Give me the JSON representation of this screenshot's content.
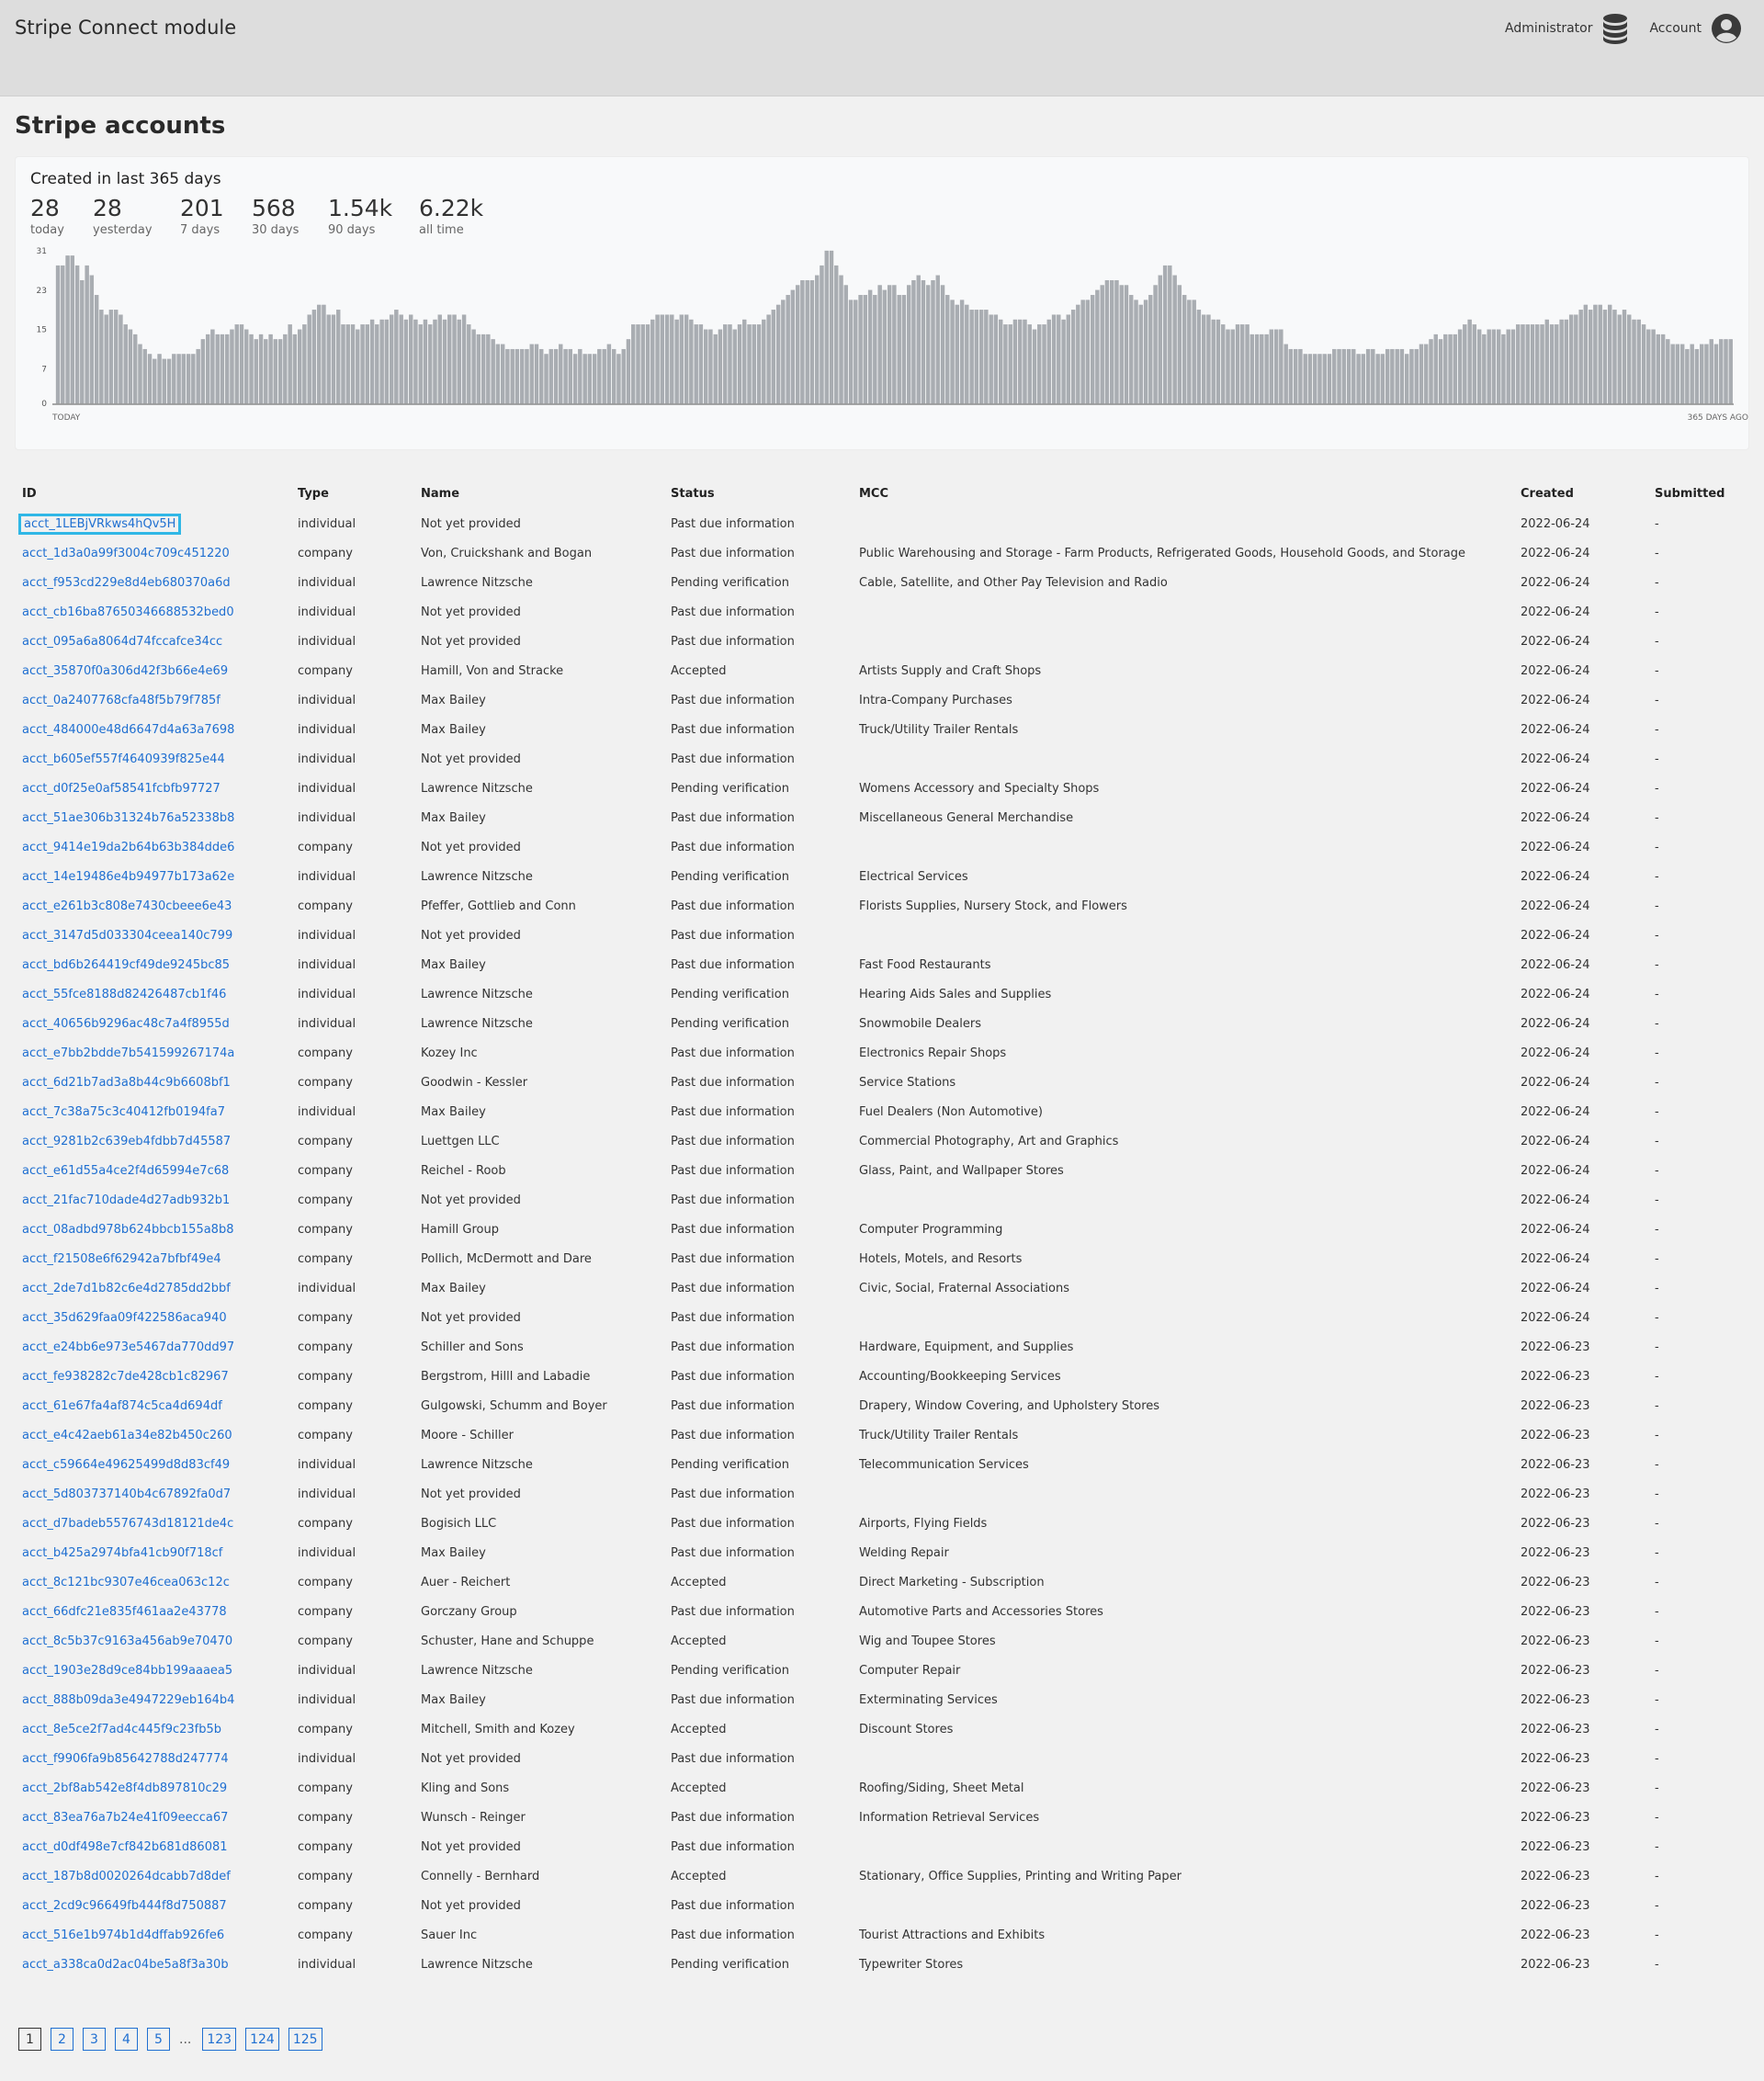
{
  "header": {
    "app_title": "Stripe Connect module",
    "admin_label": "Administrator",
    "account_label": "Account",
    "admin_icon": "database-icon",
    "account_icon": "user-circle-icon"
  },
  "page_title": "Stripe accounts",
  "stats": {
    "title": "Created in last 365 days",
    "items": [
      {
        "value": "28",
        "label": "today"
      },
      {
        "value": "28",
        "label": "yesterday"
      },
      {
        "value": "201",
        "label": "7 days"
      },
      {
        "value": "568",
        "label": "30 days"
      },
      {
        "value": "1.54k",
        "label": "90 days"
      },
      {
        "value": "6.22k",
        "label": "all time"
      }
    ]
  },
  "chart_data": {
    "type": "bar",
    "title": "",
    "y_ticks": [
      0,
      7,
      15,
      23,
      31
    ],
    "ylim": [
      0,
      31
    ],
    "x_label_left": "TODAY",
    "x_label_right": "365 DAYS AGO",
    "bar_color": "#a9adb2",
    "values": [
      28,
      28,
      30,
      30,
      28,
      25,
      28,
      26,
      22,
      19,
      18,
      19,
      19,
      18,
      16,
      15,
      14,
      12,
      11,
      10,
      9,
      10,
      9,
      9,
      10,
      10,
      10,
      10,
      10,
      11,
      13,
      14,
      15,
      14,
      14,
      14,
      15,
      16,
      16,
      15,
      14,
      13,
      14,
      13,
      14,
      13,
      13,
      14,
      16,
      14,
      15,
      16,
      18,
      19,
      20,
      20,
      18,
      18,
      19,
      16,
      16,
      16,
      15,
      16,
      16,
      17,
      16,
      17,
      17,
      18,
      19,
      18,
      17,
      18,
      17,
      16,
      17,
      16,
      17,
      18,
      17,
      18,
      18,
      17,
      18,
      16,
      15,
      14,
      14,
      14,
      13,
      12,
      12,
      11,
      11,
      11,
      11,
      11,
      12,
      12,
      11,
      10,
      11,
      11,
      12,
      11,
      11,
      10,
      11,
      10,
      10,
      10,
      11,
      11,
      12,
      11,
      10,
      11,
      13,
      16,
      16,
      16,
      16,
      17,
      18,
      18,
      18,
      18,
      17,
      18,
      18,
      17,
      16,
      16,
      15,
      15,
      14,
      15,
      16,
      16,
      15,
      16,
      17,
      16,
      16,
      16,
      17,
      18,
      19,
      20,
      21,
      22,
      23,
      24,
      25,
      25,
      25,
      26,
      28,
      31,
      31,
      28,
      26,
      24,
      21,
      21,
      22,
      22,
      23,
      22,
      24,
      23,
      24,
      24,
      22,
      22,
      24,
      25,
      26,
      25,
      24,
      25,
      26,
      24,
      22,
      21,
      20,
      21,
      20,
      19,
      19,
      19,
      19,
      18,
      18,
      17,
      16,
      16,
      17,
      17,
      17,
      16,
      15,
      16,
      16,
      17,
      18,
      18,
      17,
      18,
      19,
      20,
      21,
      21,
      22,
      23,
      24,
      25,
      25,
      25,
      24,
      24,
      22,
      21,
      20,
      21,
      22,
      24,
      26,
      28,
      28,
      26,
      24,
      22,
      21,
      21,
      19,
      18,
      18,
      17,
      17,
      16,
      15,
      15,
      16,
      16,
      16,
      14,
      14,
      14,
      14,
      15,
      15,
      15,
      12,
      11,
      11,
      11,
      10,
      10,
      10,
      10,
      10,
      10,
      11,
      11,
      11,
      11,
      11,
      10,
      10,
      11,
      11,
      10,
      10,
      11,
      11,
      11,
      11,
      10,
      11,
      11,
      12,
      12,
      13,
      14,
      13,
      14,
      14,
      14,
      15,
      16,
      17,
      16,
      15,
      14,
      15,
      15,
      15,
      14,
      15,
      15,
      16,
      16,
      16,
      16,
      16,
      16,
      17,
      16,
      16,
      17,
      17,
      18,
      18,
      19,
      20,
      19,
      20,
      20,
      19,
      20,
      19,
      18,
      19,
      18,
      17,
      17,
      16,
      15,
      15,
      14,
      14,
      13,
      12,
      12,
      12,
      11,
      12,
      11,
      12,
      12,
      13,
      12,
      13,
      13,
      13
    ],
    "note_order": "values listed from TODAY (left) to 365 DAYS AGO (right)"
  },
  "table": {
    "columns": [
      "ID",
      "Type",
      "Name",
      "Status",
      "MCC",
      "Created",
      "Submitted"
    ],
    "rows": [
      [
        "acct_1LEBjVRkws4hQv5H",
        "individual",
        "Not yet provided",
        "Past due information",
        "",
        "2022-06-24",
        "-"
      ],
      [
        "acct_1d3a0a99f3004c709c451220",
        "company",
        "Von, Cruickshank and Bogan",
        "Past due information",
        "Public Warehousing and Storage - Farm Products, Refrigerated Goods, Household Goods, and Storage",
        "2022-06-24",
        "-"
      ],
      [
        "acct_f953cd229e8d4eb680370a6d",
        "individual",
        "Lawrence Nitzsche",
        "Pending verification",
        "Cable, Satellite, and Other Pay Television and Radio",
        "2022-06-24",
        "-"
      ],
      [
        "acct_cb16ba87650346688532bed0",
        "individual",
        "Not yet provided",
        "Past due information",
        "",
        "2022-06-24",
        "-"
      ],
      [
        "acct_095a6a8064d74fccafce34cc",
        "individual",
        "Not yet provided",
        "Past due information",
        "",
        "2022-06-24",
        "-"
      ],
      [
        "acct_35870f0a306d42f3b66e4e69",
        "company",
        "Hamill, Von and Stracke",
        "Accepted",
        "Artists Supply and Craft Shops",
        "2022-06-24",
        "-"
      ],
      [
        "acct_0a2407768cfa48f5b79f785f",
        "individual",
        "Max Bailey",
        "Past due information",
        "Intra-Company Purchases",
        "2022-06-24",
        "-"
      ],
      [
        "acct_484000e48d6647d4a63a7698",
        "individual",
        "Max Bailey",
        "Past due information",
        "Truck/Utility Trailer Rentals",
        "2022-06-24",
        "-"
      ],
      [
        "acct_b605ef557f4640939f825e44",
        "individual",
        "Not yet provided",
        "Past due information",
        "",
        "2022-06-24",
        "-"
      ],
      [
        "acct_d0f25e0af58541fcbfb97727",
        "individual",
        "Lawrence Nitzsche",
        "Pending verification",
        "Womens Accessory and Specialty Shops",
        "2022-06-24",
        "-"
      ],
      [
        "acct_51ae306b31324b76a52338b8",
        "individual",
        "Max Bailey",
        "Past due information",
        "Miscellaneous General Merchandise",
        "2022-06-24",
        "-"
      ],
      [
        "acct_9414e19da2b64b63b384dde6",
        "company",
        "Not yet provided",
        "Past due information",
        "",
        "2022-06-24",
        "-"
      ],
      [
        "acct_14e19486e4b94977b173a62e",
        "individual",
        "Lawrence Nitzsche",
        "Pending verification",
        "Electrical Services",
        "2022-06-24",
        "-"
      ],
      [
        "acct_e261b3c808e7430cbeee6e43",
        "company",
        "Pfeffer, Gottlieb and Conn",
        "Past due information",
        "Florists Supplies, Nursery Stock, and Flowers",
        "2022-06-24",
        "-"
      ],
      [
        "acct_3147d5d033304ceea140c799",
        "individual",
        "Not yet provided",
        "Past due information",
        "",
        "2022-06-24",
        "-"
      ],
      [
        "acct_bd6b264419cf49de9245bc85",
        "individual",
        "Max Bailey",
        "Past due information",
        "Fast Food Restaurants",
        "2022-06-24",
        "-"
      ],
      [
        "acct_55fce8188d82426487cb1f46",
        "individual",
        "Lawrence Nitzsche",
        "Pending verification",
        "Hearing Aids Sales and Supplies",
        "2022-06-24",
        "-"
      ],
      [
        "acct_40656b9296ac48c7a4f8955d",
        "individual",
        "Lawrence Nitzsche",
        "Pending verification",
        "Snowmobile Dealers",
        "2022-06-24",
        "-"
      ],
      [
        "acct_e7bb2bdde7b541599267174a",
        "company",
        "Kozey Inc",
        "Past due information",
        "Electronics Repair Shops",
        "2022-06-24",
        "-"
      ],
      [
        "acct_6d21b7ad3a8b44c9b6608bf1",
        "company",
        "Goodwin - Kessler",
        "Past due information",
        "Service Stations",
        "2022-06-24",
        "-"
      ],
      [
        "acct_7c38a75c3c40412fb0194fa7",
        "individual",
        "Max Bailey",
        "Past due information",
        "Fuel Dealers (Non Automotive)",
        "2022-06-24",
        "-"
      ],
      [
        "acct_9281b2c639eb4fdbb7d45587",
        "company",
        "Luettgen LLC",
        "Past due information",
        "Commercial Photography, Art and Graphics",
        "2022-06-24",
        "-"
      ],
      [
        "acct_e61d55a4ce2f4d65994e7c68",
        "company",
        "Reichel - Roob",
        "Past due information",
        "Glass, Paint, and Wallpaper Stores",
        "2022-06-24",
        "-"
      ],
      [
        "acct_21fac710dade4d27adb932b1",
        "company",
        "Not yet provided",
        "Past due information",
        "",
        "2022-06-24",
        "-"
      ],
      [
        "acct_08adbd978b624bbcb155a8b8",
        "company",
        "Hamill Group",
        "Past due information",
        "Computer Programming",
        "2022-06-24",
        "-"
      ],
      [
        "acct_f21508e6f62942a7bfbf49e4",
        "company",
        "Pollich, McDermott and Dare",
        "Past due information",
        "Hotels, Motels, and Resorts",
        "2022-06-24",
        "-"
      ],
      [
        "acct_2de7d1b82c6e4d2785dd2bbf",
        "individual",
        "Max Bailey",
        "Past due information",
        "Civic, Social, Fraternal Associations",
        "2022-06-24",
        "-"
      ],
      [
        "acct_35d629faa09f422586aca940",
        "company",
        "Not yet provided",
        "Past due information",
        "",
        "2022-06-24",
        "-"
      ],
      [
        "acct_e24bb6e973e5467da770dd97",
        "company",
        "Schiller and Sons",
        "Past due information",
        "Hardware, Equipment, and Supplies",
        "2022-06-23",
        "-"
      ],
      [
        "acct_fe938282c7de428cb1c82967",
        "company",
        "Bergstrom, Hilll and Labadie",
        "Past due information",
        "Accounting/Bookkeeping Services",
        "2022-06-23",
        "-"
      ],
      [
        "acct_61e67fa4af874c5ca4d694df",
        "company",
        "Gulgowski, Schumm and Boyer",
        "Past due information",
        "Drapery, Window Covering, and Upholstery Stores",
        "2022-06-23",
        "-"
      ],
      [
        "acct_e4c42aeb61a34e82b450c260",
        "company",
        "Moore - Schiller",
        "Past due information",
        "Truck/Utility Trailer Rentals",
        "2022-06-23",
        "-"
      ],
      [
        "acct_c59664e49625499d8d83cf49",
        "individual",
        "Lawrence Nitzsche",
        "Pending verification",
        "Telecommunication Services",
        "2022-06-23",
        "-"
      ],
      [
        "acct_5d803737140b4c67892fa0d7",
        "individual",
        "Not yet provided",
        "Past due information",
        "",
        "2022-06-23",
        "-"
      ],
      [
        "acct_d7badeb5576743d18121de4c",
        "company",
        "Bogisich LLC",
        "Past due information",
        "Airports, Flying Fields",
        "2022-06-23",
        "-"
      ],
      [
        "acct_b425a2974bfa41cb90f718cf",
        "individual",
        "Max Bailey",
        "Past due information",
        "Welding Repair",
        "2022-06-23",
        "-"
      ],
      [
        "acct_8c121bc9307e46cea063c12c",
        "company",
        "Auer - Reichert",
        "Accepted",
        "Direct Marketing - Subscription",
        "2022-06-23",
        "-"
      ],
      [
        "acct_66dfc21e835f461aa2e43778",
        "company",
        "Gorczany Group",
        "Past due information",
        "Automotive Parts and Accessories Stores",
        "2022-06-23",
        "-"
      ],
      [
        "acct_8c5b37c9163a456ab9e70470",
        "company",
        "Schuster, Hane and Schuppe",
        "Accepted",
        "Wig and Toupee Stores",
        "2022-06-23",
        "-"
      ],
      [
        "acct_1903e28d9ce84bb199aaaea5",
        "individual",
        "Lawrence Nitzsche",
        "Pending verification",
        "Computer Repair",
        "2022-06-23",
        "-"
      ],
      [
        "acct_888b09da3e4947229eb164b4",
        "individual",
        "Max Bailey",
        "Past due information",
        "Exterminating Services",
        "2022-06-23",
        "-"
      ],
      [
        "acct_8e5ce2f7ad4c445f9c23fb5b",
        "company",
        "Mitchell, Smith and Kozey",
        "Accepted",
        "Discount Stores",
        "2022-06-23",
        "-"
      ],
      [
        "acct_f9906fa9b85642788d247774",
        "individual",
        "Not yet provided",
        "Past due information",
        "",
        "2022-06-23",
        "-"
      ],
      [
        "acct_2bf8ab542e8f4db897810c29",
        "company",
        "Kling and Sons",
        "Accepted",
        "Roofing/Siding, Sheet Metal",
        "2022-06-23",
        "-"
      ],
      [
        "acct_83ea76a7b24e41f09eecca67",
        "company",
        "Wunsch - Reinger",
        "Past due information",
        "Information Retrieval Services",
        "2022-06-23",
        "-"
      ],
      [
        "acct_d0df498e7cf842b681d86081",
        "company",
        "Not yet provided",
        "Past due information",
        "",
        "2022-06-23",
        "-"
      ],
      [
        "acct_187b8d0020264dcabb7d8def",
        "company",
        "Connelly - Bernhard",
        "Accepted",
        "Stationary, Office Supplies, Printing and Writing Paper",
        "2022-06-23",
        "-"
      ],
      [
        "acct_2cd9c96649fb444f8d750887",
        "company",
        "Not yet provided",
        "Past due information",
        "",
        "2022-06-23",
        "-"
      ],
      [
        "acct_516e1b974b1d4dffab926fe6",
        "company",
        "Sauer Inc",
        "Past due information",
        "Tourist Attractions and Exhibits",
        "2022-06-23",
        "-"
      ],
      [
        "acct_a338ca0d2ac04be5a8f3a30b",
        "individual",
        "Lawrence Nitzsche",
        "Pending verification",
        "Typewriter Stores",
        "2022-06-23",
        "-"
      ]
    ]
  },
  "pagination": {
    "pages_start": [
      "1",
      "2",
      "3",
      "4",
      "5"
    ],
    "ellipsis": "...",
    "pages_end": [
      "123",
      "124",
      "125"
    ],
    "current": "1"
  }
}
